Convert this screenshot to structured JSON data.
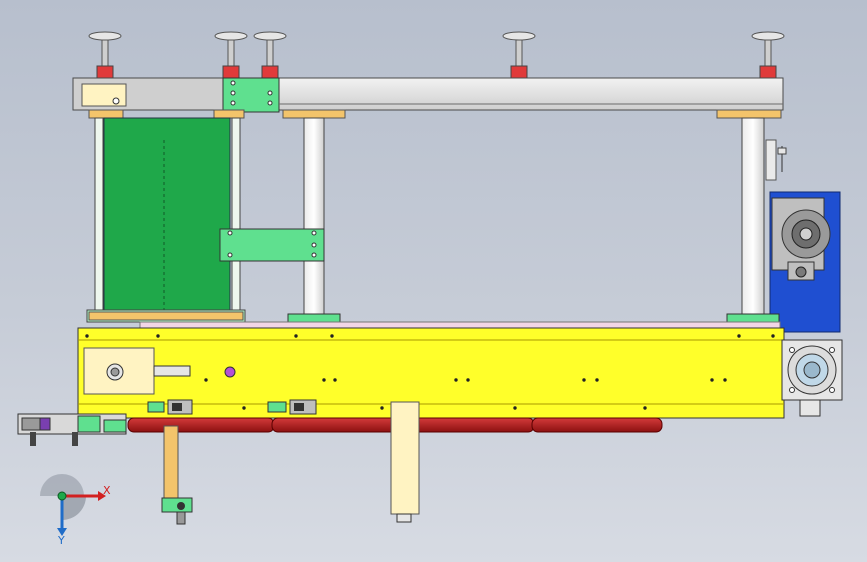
{
  "view": {
    "type": "cad-orthographic-view",
    "background_gradient": [
      "#b7bfcd",
      "#d7dbe3"
    ]
  },
  "colors": {
    "frame_gray": "#d9d9d9",
    "frame_edge": "#4a4a4a",
    "mounting_plate_green": "#1fa84a",
    "bracket_green": "#5fe08f",
    "base_yellow": "#ffff2a",
    "pad_orange": "#f3c46b",
    "foot_red": "#e03a3a",
    "wheel_red": "#b51a1a",
    "motor_blue": "#1f4fd1",
    "cream": "#fff3c2",
    "axis_x": "#d22020",
    "axis_y": "#1f6cc8",
    "axis_origin": "#1fa84a"
  },
  "triad": {
    "x_label": "X",
    "y_label": "Y"
  },
  "components": [
    {
      "name": "leveling-foot",
      "count": 5
    },
    {
      "name": "upper-frame-beam",
      "count": 1
    },
    {
      "name": "vertical-post",
      "count": 4
    },
    {
      "name": "green-mounting-plate",
      "count": 1
    },
    {
      "name": "yellow-base-frame",
      "count": 1
    },
    {
      "name": "gear-motor",
      "count": 1
    },
    {
      "name": "conveyor-wheel",
      "count": 3
    },
    {
      "name": "sensor-bracket",
      "count": 2
    }
  ]
}
